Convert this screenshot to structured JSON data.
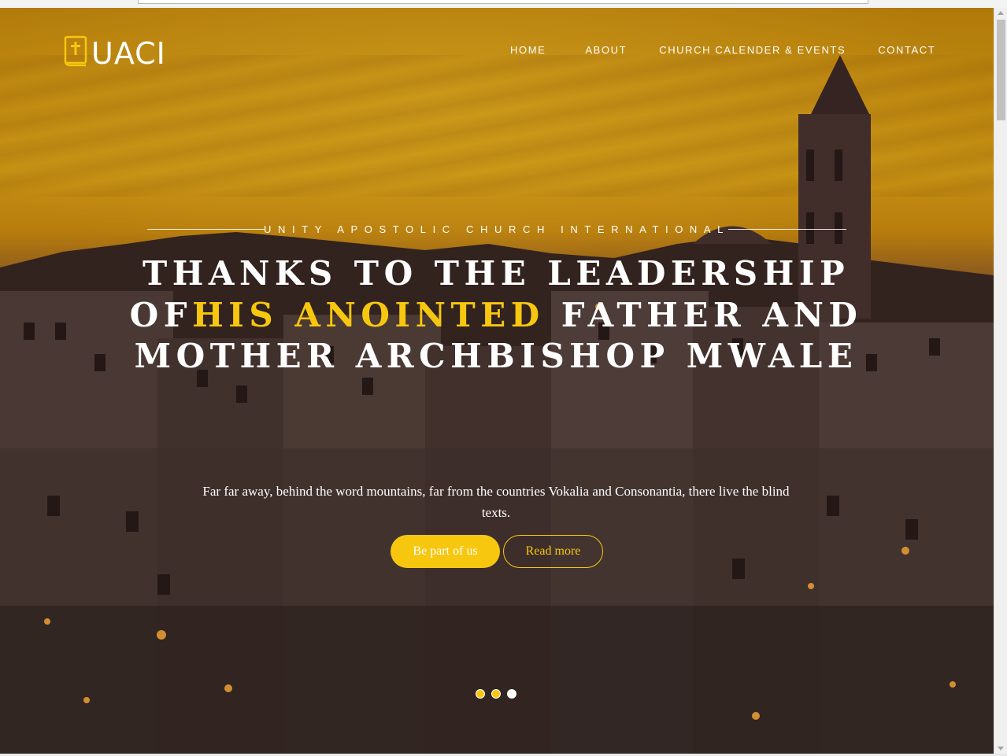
{
  "brand": {
    "name": "UACI",
    "icon": "bible-icon",
    "accent_color": "#f7c70f"
  },
  "nav": {
    "items": [
      {
        "label": "HOME"
      },
      {
        "label": "ABOUT"
      },
      {
        "label": "CHURCH CALENDER & EVENTS"
      },
      {
        "label": "CONTACT"
      }
    ]
  },
  "hero": {
    "subtitle": "UNITY APOSTOLIC CHURCH INTERNATIONAL",
    "headline": {
      "part1": "THANKS TO THE LEADERSHIP OF",
      "highlight": "HIS ANOINTED",
      "part2": " FATHER AND MOTHER ARCHBISHOP MWALE"
    },
    "description": "Far far away, behind the word mountains, far from the countries Vokalia and Consonantia, there live the blind texts.",
    "primary_button": "Be part of us",
    "secondary_button": "Read more",
    "slides": {
      "count": 3,
      "active": 3
    }
  }
}
